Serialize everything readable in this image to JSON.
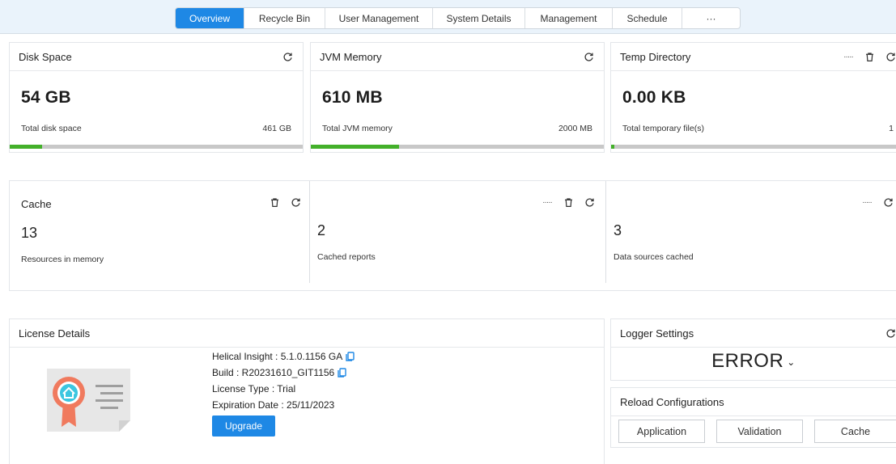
{
  "tabs": [
    {
      "label": "Overview",
      "active": true
    },
    {
      "label": "Recycle Bin"
    },
    {
      "label": "User Management"
    },
    {
      "label": "System Details"
    },
    {
      "label": "Management"
    },
    {
      "label": "Schedule"
    },
    {
      "label": "···"
    }
  ],
  "disk": {
    "title": "Disk Space",
    "value": "54 GB",
    "sub_label": "Total disk space",
    "total": "461 GB",
    "fill_fraction": 0.11
  },
  "jvm": {
    "title": "JVM Memory",
    "value": "610 MB",
    "sub_label": "Total JVM memory",
    "total": "2000 MB",
    "fill_fraction": 0.3
  },
  "temp": {
    "title": "Temp Directory",
    "value": "0.00 KB",
    "sub_label": "Total temporary file(s)",
    "total": "1",
    "fill_fraction": 0.01
  },
  "cache": {
    "title": "Cache",
    "resources": {
      "value": "13",
      "label": "Resources in memory"
    },
    "reports": {
      "value": "2",
      "label": "Cached reports"
    },
    "datasources": {
      "value": "3",
      "label": "Data sources cached"
    }
  },
  "license": {
    "title": "License Details",
    "helical_insight": "Helical Insight : 5.1.0.1156 GA",
    "build": "Build : R20231610_GIT1156",
    "license_type": "License Type : Trial",
    "expiration": "Expiration Date : 25/11/2023",
    "upgrade_label": "Upgrade"
  },
  "logger": {
    "title": "Logger Settings",
    "level": "ERROR"
  },
  "reload": {
    "title": "Reload Configurations",
    "buttons": [
      "Application",
      "Validation",
      "Cache"
    ]
  },
  "colors": {
    "accent": "#1e88e5",
    "progress_fill": "#43b02a",
    "progress_track": "#c8c8c8",
    "topbar_bg": "#eaf3fb"
  },
  "icons": {
    "refresh": "refresh-icon",
    "delete": "trash-icon",
    "more": "more-dots-icon",
    "copy": "copy-icon",
    "license": "license-certificate-icon",
    "caret": "chevron-down-icon"
  }
}
